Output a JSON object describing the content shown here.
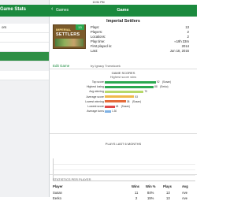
{
  "statusbar": {
    "time": "12:51 PM"
  },
  "sidebar": {
    "title": "Game Stats",
    "items": [
      {
        "label": "ors"
      },
      {
        "label": ""
      },
      {
        "label": ""
      },
      {
        "label": ""
      },
      {
        "label": ""
      }
    ]
  },
  "header": {
    "back_icon": "‹",
    "back_label": "Games",
    "title": "Game"
  },
  "game": {
    "name": "Imperial Settlers",
    "badge": "13",
    "cover_brand": "IMPERIAL",
    "cover_title": "SETTLERS",
    "edit_label": "Edit Game",
    "byline": "by Ignacy Trzewiczek",
    "info": [
      {
        "k": "Plays:",
        "v": "13"
      },
      {
        "k": "Players:",
        "v": "2"
      },
      {
        "k": "Locations:",
        "v": "2"
      },
      {
        "k": "Play time:",
        "v": "≈19h 33m"
      },
      {
        "k": "First played in:",
        "v": "2014"
      },
      {
        "k": "Last:",
        "v": "Jun 18, 2016"
      }
    ]
  },
  "scores": {
    "title": "GAME SCORES",
    "subtitle": "Highest score wins"
  },
  "chart_data": {
    "type": "bar",
    "categories": [
      "Top score",
      "Highest losing",
      "Avg winning",
      "Average score",
      "Lowest winning",
      "Lowest score",
      "Average turns"
    ],
    "values": [
      92,
      88,
      70,
      53,
      38,
      18,
      1.3
    ],
    "value_labels": [
      "92",
      "88",
      "70",
      "53",
      "38",
      "18",
      "1.30"
    ],
    "extra_labels": [
      "(Susan)",
      "(Eerko)",
      "",
      "",
      "(Susan)",
      "(Susan)",
      ""
    ],
    "colors": [
      "#2aa84f",
      "#2aa84f",
      "#b6d96a",
      "#f0b84a",
      "#e56b3a",
      "#e04848",
      "#7fb2e5"
    ]
  },
  "plays": {
    "title": "PLAYS LAST 6 MONTHS"
  },
  "stats": {
    "title": "STATISTICS PER PLAYER",
    "headers": [
      "Player",
      "Wins",
      "Win %",
      "Plays",
      "Avg"
    ],
    "rows": [
      {
        "player": "Susan",
        "wins": "11",
        "pct": "84%",
        "plays": "13",
        "avg": "Ave"
      },
      {
        "player": "Eerko",
        "wins": "2",
        "pct": "15%",
        "plays": "13",
        "avg": "Ave"
      }
    ]
  }
}
